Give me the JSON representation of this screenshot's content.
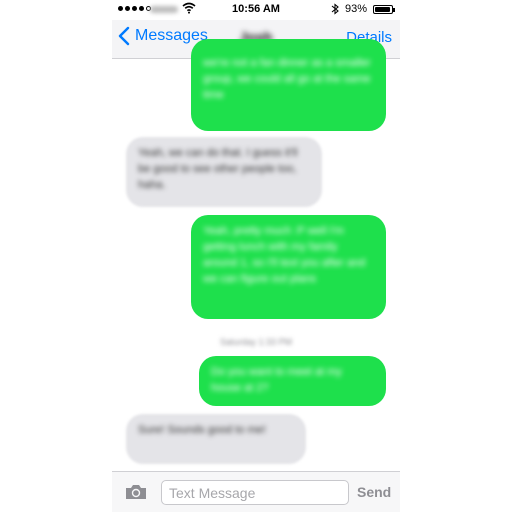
{
  "status_bar": {
    "time": "10:56 AM",
    "battery_percent": "93%",
    "battery_level": 0.93,
    "signal_dots_filled": 4,
    "signal_dots_total": 5
  },
  "nav": {
    "back_label": "Messages",
    "contact_name": "Josh",
    "details_label": "Details"
  },
  "messages": [
    {
      "direction": "out",
      "text": "we're not a fan dinner as a smaller group, we could all go at the same time"
    },
    {
      "direction": "in",
      "text": "Yeah, we can do that. I guess it'll be good to see other people too, haha."
    },
    {
      "direction": "out",
      "text": "Yeah, pretty much :P well I'm getting lunch with my family around 1, so I'll text you after and we can figure out plans"
    },
    {
      "direction": "out",
      "text": "Do you want to meet at my house at 2?"
    },
    {
      "direction": "in",
      "text": "Sure! Sounds good to me!"
    }
  ],
  "timestamp": "Saturday 1:33 PM",
  "input": {
    "placeholder": "Text Message",
    "send_label": "Send"
  },
  "colors": {
    "accent": "#007aff",
    "outgoing_bubble": "#1ee04c",
    "incoming_bubble": "#e4e4e8"
  },
  "icons": {
    "back": "chevron-left-icon",
    "camera": "camera-icon",
    "wifi": "wifi-icon",
    "bluetooth": "bluetooth-icon",
    "battery": "battery-icon"
  }
}
